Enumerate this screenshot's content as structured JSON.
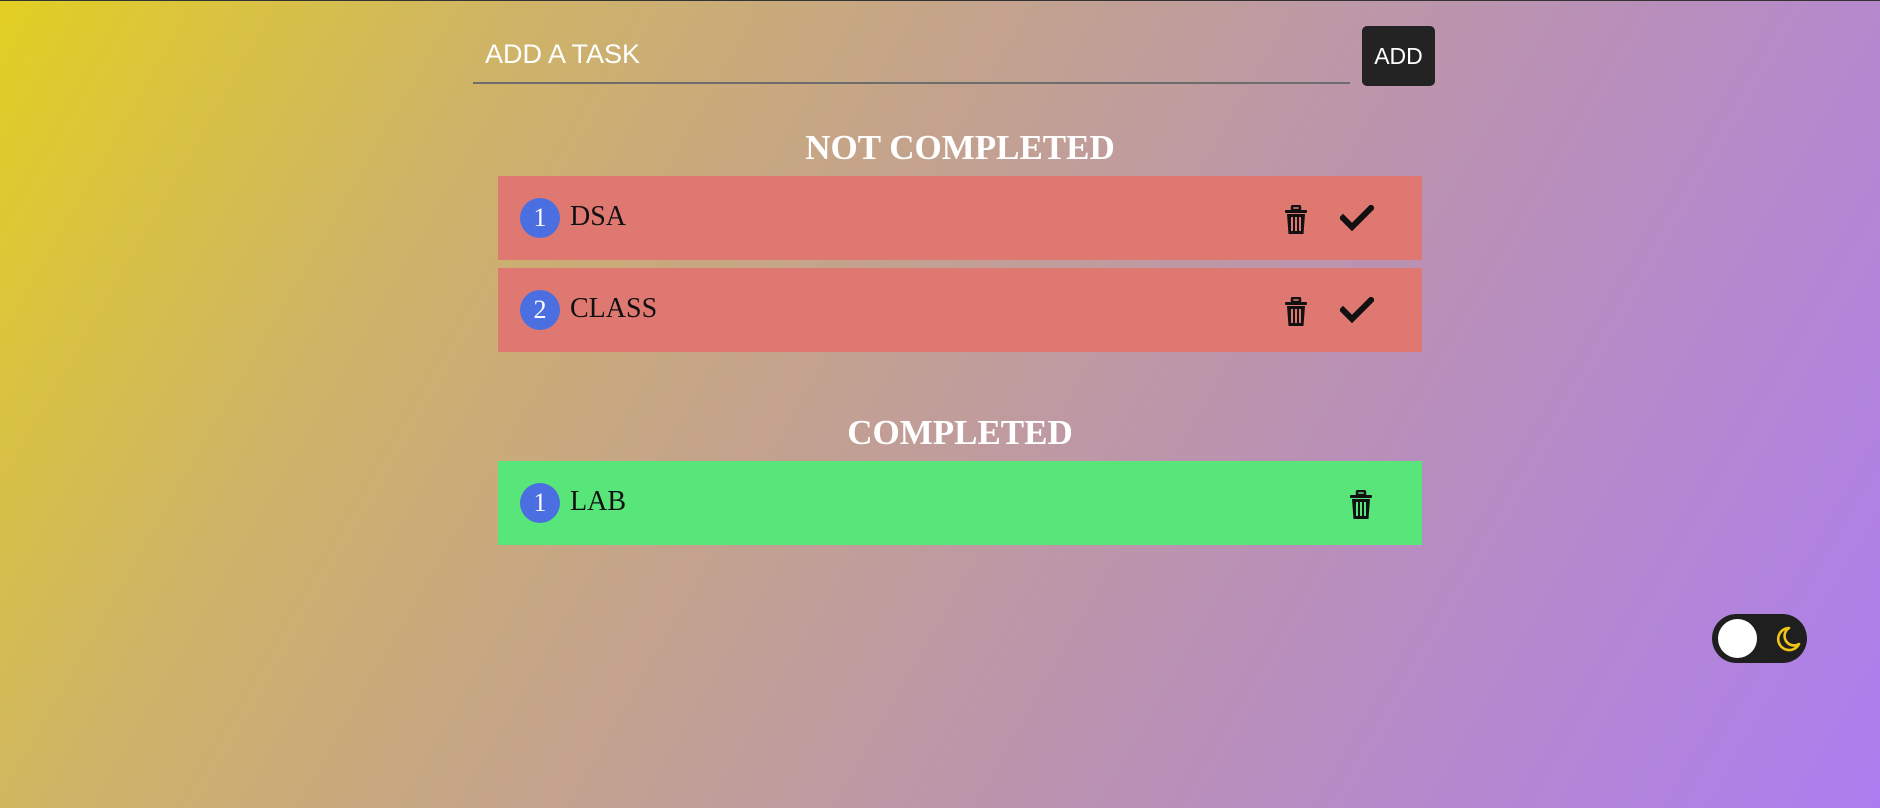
{
  "input": {
    "placeholder": "ADD A TASK",
    "value": ""
  },
  "add_button_label": "ADD",
  "sections": {
    "not_completed": {
      "title": "NOT COMPLETED",
      "tasks": [
        {
          "number": "1",
          "text": "DSA"
        },
        {
          "number": "2",
          "text": "CLASS"
        }
      ]
    },
    "completed": {
      "title": "COMPLETED",
      "tasks": [
        {
          "number": "1",
          "text": "LAB"
        }
      ]
    }
  },
  "icons": {
    "delete": "trash-icon",
    "complete": "checkmark-icon",
    "theme": "moon-icon"
  },
  "colors": {
    "not_completed_row": "#e07872",
    "completed_row": "#58e57a",
    "number_badge": "#4b6fe0",
    "add_button": "#232323",
    "toggle_background": "#1f1f1f",
    "moon": "#f0c419"
  },
  "theme_toggle": {
    "dark_mode": false
  }
}
